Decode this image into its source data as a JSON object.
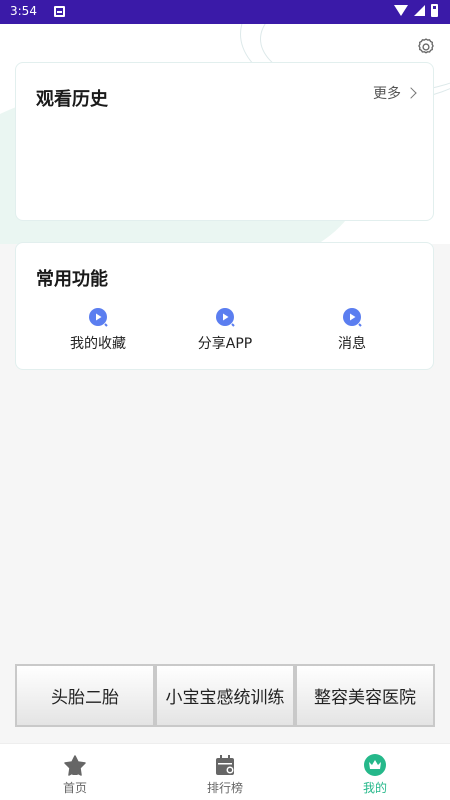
{
  "status_bar": {
    "time": "3:54"
  },
  "history": {
    "title": "观看历史",
    "more_label": "更多"
  },
  "functions": {
    "title": "常用功能",
    "items": [
      {
        "label": "我的收藏",
        "icon": "play-icon"
      },
      {
        "label": "分享APP",
        "icon": "play-icon"
      },
      {
        "label": "消息",
        "icon": "play-icon"
      }
    ]
  },
  "tags": [
    "头胎二胎",
    "小宝宝感统训练",
    "整容美容医院"
  ],
  "tabs": [
    {
      "label": "首页",
      "icon": "home-icon",
      "active": false
    },
    {
      "label": "排行榜",
      "icon": "calendar-icon",
      "active": false
    },
    {
      "label": "我的",
      "icon": "crown-icon",
      "active": true
    }
  ],
  "colors": {
    "status_bar": "#3a1aa8",
    "accent": "#25b88a",
    "play_icon": "#5b7ef0"
  }
}
